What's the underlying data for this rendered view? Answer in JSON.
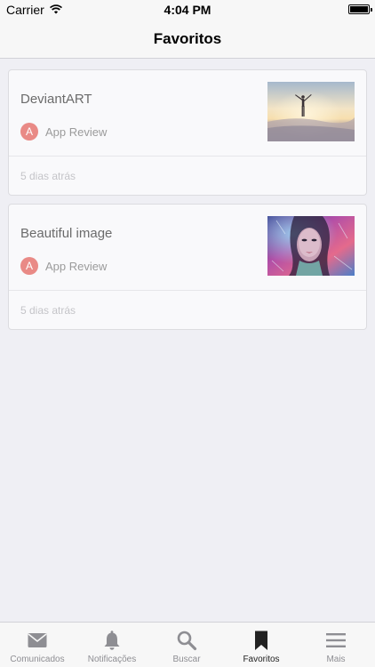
{
  "status_bar": {
    "carrier": "Carrier",
    "time": "4:04 PM",
    "wifi_icon": "wifi-icon",
    "battery_icon": "battery-icon"
  },
  "nav": {
    "title": "Favoritos"
  },
  "favorites": [
    {
      "title": "DeviantART",
      "author_initial": "A",
      "author": "App Review",
      "date": "5 dias atrás",
      "thumbnail": "person-desert-sunset-photo"
    },
    {
      "title": "Beautiful image",
      "author_initial": "A",
      "author": "App Review",
      "date": "5 dias atrás",
      "thumbnail": "colorful-woman-portrait-photo"
    }
  ],
  "tabs": [
    {
      "label": "Comunicados",
      "icon": "envelope-icon",
      "active": false
    },
    {
      "label": "Notificações",
      "icon": "bell-icon",
      "active": false
    },
    {
      "label": "Buscar",
      "icon": "search-icon",
      "active": false
    },
    {
      "label": "Favoritos",
      "icon": "bookmark-icon",
      "active": true
    },
    {
      "label": "Mais",
      "icon": "menu-icon",
      "active": false
    }
  ],
  "colors": {
    "background": "#efeff4",
    "avatar": "#e98a86",
    "active_tab": "#222222",
    "inactive_tab": "#8e8e93"
  }
}
